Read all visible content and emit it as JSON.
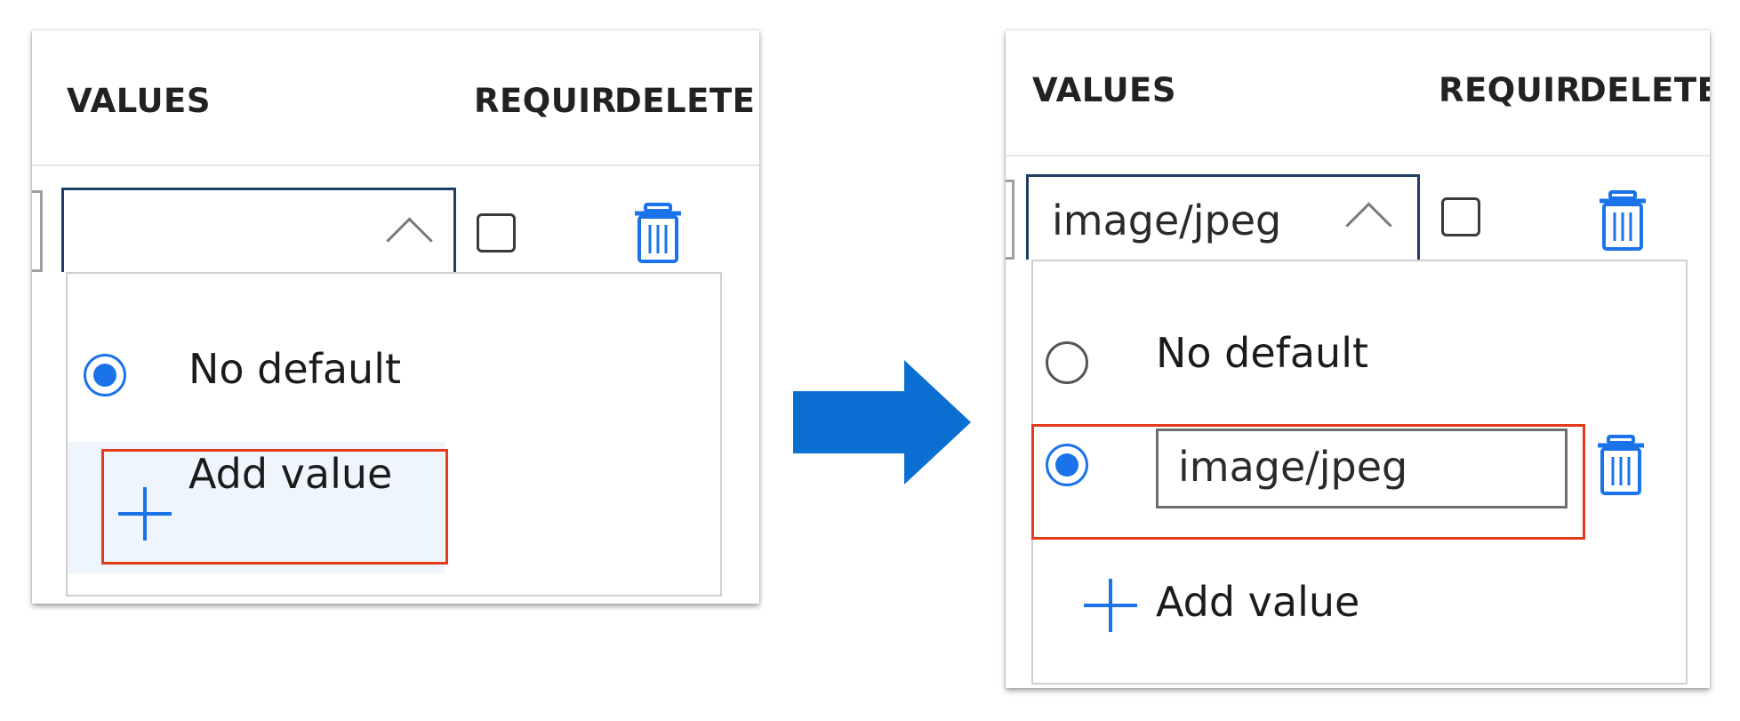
{
  "before": {
    "headers": {
      "values": "VALUES",
      "required": "REQUIR",
      "delete": "DELETE"
    },
    "combo_value": "",
    "options": {
      "no_default": "No default",
      "add_value": "Add value"
    },
    "selected": "no_default",
    "required_checked": false
  },
  "after": {
    "headers": {
      "values": "VALUES",
      "required": "REQUIR",
      "delete": "DELETE"
    },
    "combo_value": "image/jpeg",
    "options": {
      "no_default": "No default",
      "add_value": "Add value"
    },
    "new_value_input": "image/jpeg",
    "selected": "new_value",
    "required_checked": false
  },
  "colors": {
    "accent": "#1a73e8",
    "highlight": "#e23b1c",
    "arrow": "#0a6fd0",
    "combo_border": "#1f3e66"
  },
  "icons": [
    "chevron-up-icon",
    "trash-icon",
    "plus-icon",
    "arrow-right-icon"
  ]
}
